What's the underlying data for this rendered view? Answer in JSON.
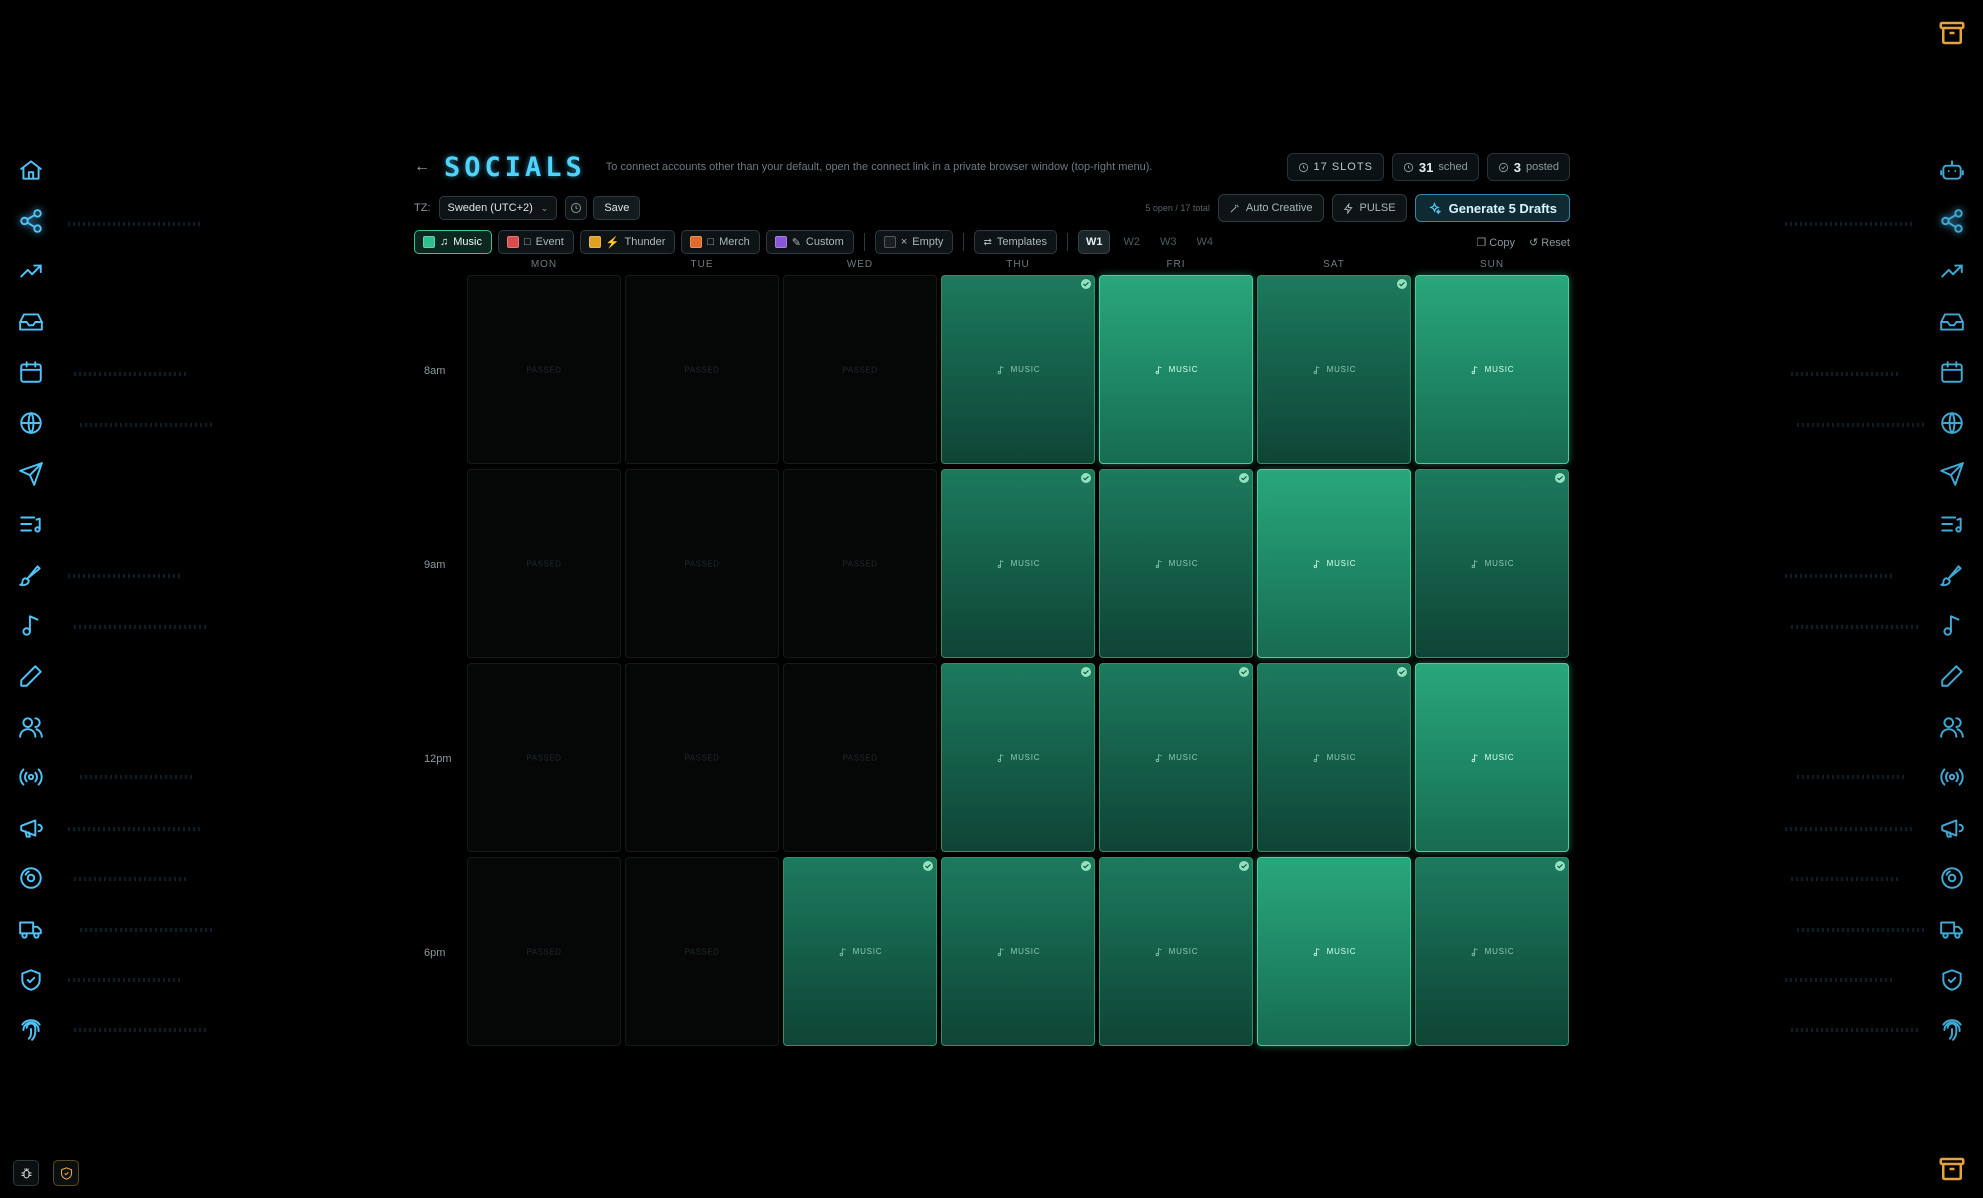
{
  "header": {
    "title": "SOCIALS",
    "subtitle": "To connect accounts other than your default, open the connect link in a private browser window (top-right menu).",
    "stats": {
      "slots": "17 SLOTS",
      "scheduled_count": "31",
      "scheduled_label": "sched",
      "posted_count": "3",
      "posted_label": "posted"
    }
  },
  "toolbar": {
    "tz_label": "TZ:",
    "tz_value": "Sweden (UTC+2)",
    "save_label": "Save",
    "counts": "5 open / 17 total",
    "auto_creative": "Auto Creative",
    "pulse": "PULSE",
    "generate": "Generate 5 Drafts"
  },
  "filters": {
    "chips": [
      {
        "label": "Music",
        "color": "#2fbf8f",
        "active": true
      },
      {
        "label": "Event",
        "color": "#d94b4b",
        "active": false
      },
      {
        "label": "Thunder",
        "color": "#e0a020",
        "active": false
      },
      {
        "label": "Merch",
        "color": "#e06a2a",
        "active": false
      },
      {
        "label": "Custom",
        "color": "#8a55d9",
        "active": false
      }
    ],
    "empty_label": "Empty",
    "templates_label": "Templates",
    "weeks": [
      "W1",
      "W2",
      "W3",
      "W4"
    ],
    "active_week": "W1",
    "copy_label": "Copy",
    "reset_label": "Reset"
  },
  "calendar": {
    "days": [
      "MON",
      "TUE",
      "WED",
      "THU",
      "FRI",
      "SAT",
      "SUN"
    ],
    "times": [
      "8am",
      "9am",
      "12pm",
      "6pm"
    ],
    "passed_label": "PASSED",
    "slot_label": "MUSIC",
    "rows": [
      [
        "passed",
        "passed",
        "passed",
        "sched-posted",
        "bright",
        "sched-posted",
        "bright"
      ],
      [
        "passed",
        "passed",
        "passed",
        "sched-posted",
        "sched-posted",
        "bright",
        "sched-posted"
      ],
      [
        "passed",
        "passed",
        "passed",
        "sched-posted",
        "sched-posted",
        "sched-posted",
        "bright"
      ],
      [
        "passed",
        "passed",
        "sched-posted",
        "sched-posted",
        "sched-posted",
        "bright",
        "sched-posted"
      ]
    ]
  },
  "colors": {
    "accent": "#4fd3ff",
    "scheduled": "#1c7a5d",
    "bright": "#29a77c",
    "warning": "#e6a23c"
  },
  "nav_icons": [
    "home-icon",
    "share-icon",
    "trending-icon",
    "inbox-icon",
    "calendar-icon",
    "globe-icon",
    "send-icon",
    "playlist-icon",
    "brush-icon",
    "music-note-icon",
    "pen-icon",
    "users-icon",
    "broadcast-icon",
    "megaphone-icon",
    "disc-icon",
    "truck-icon",
    "shield-check-icon",
    "fingerprint-icon"
  ]
}
